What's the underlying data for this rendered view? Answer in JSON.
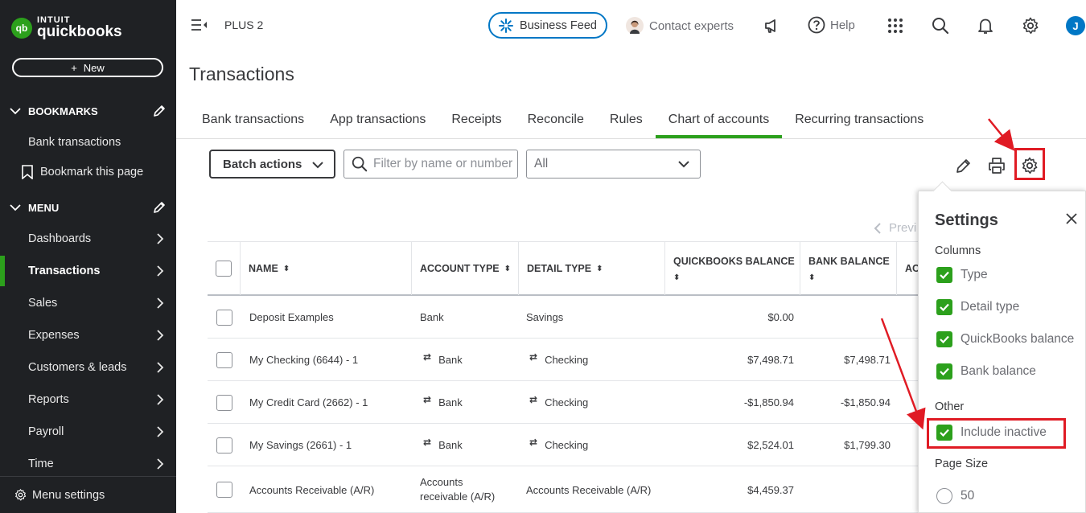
{
  "brand": {
    "mark": "qb",
    "line1": "INTUIT",
    "line2": "quickbooks"
  },
  "sidebar": {
    "new_label": "New",
    "bookmarks_heading": "BOOKMARKS",
    "bookmarks": [
      "Bank transactions",
      "Bookmark this page"
    ],
    "menu_heading": "MENU",
    "menu_items": [
      "Dashboards",
      "Transactions",
      "Sales",
      "Expenses",
      "Customers & leads",
      "Reports",
      "Payroll",
      "Time"
    ],
    "active_item": "Transactions",
    "menu_settings": "Menu settings",
    "accent": "#2ca01c"
  },
  "topbar": {
    "plan": "PLUS 2",
    "business_feed": "Business Feed",
    "contact_experts": "Contact experts",
    "help": "Help",
    "avatar_initial": "J",
    "accent": "#0077c5"
  },
  "page": {
    "title": "Transactions",
    "tabs": [
      "Bank transactions",
      "App transactions",
      "Receipts",
      "Reconcile",
      "Rules",
      "Chart of accounts",
      "Recurring transactions"
    ],
    "active_tab": "Chart of accounts"
  },
  "toolbar": {
    "batch_actions": "Batch actions",
    "filter_placeholder": "Filter by name or number",
    "filter_select": "All",
    "prev": "Previ"
  },
  "table": {
    "headers": [
      "NAME",
      "ACCOUNT TYPE",
      "DETAIL TYPE",
      "QUICKBOOKS BALANCE",
      "BANK BALANCE",
      "ACTI"
    ],
    "rows": [
      {
        "name": "Deposit Examples",
        "account_type": "Bank",
        "detail_type": "Savings",
        "qb_balance": "$0.00",
        "bank_balance": "",
        "linked": false
      },
      {
        "name": "My Checking (6644) - 1",
        "account_type": "Bank",
        "detail_type": "Checking",
        "qb_balance": "$7,498.71",
        "bank_balance": "$7,498.71",
        "linked": true
      },
      {
        "name": "My Credit Card (2662) - 1",
        "account_type": "Bank",
        "detail_type": "Checking",
        "qb_balance": "-$1,850.94",
        "bank_balance": "-$1,850.94",
        "linked": true
      },
      {
        "name": "My Savings (2661) - 1",
        "account_type": "Bank",
        "detail_type": "Checking",
        "qb_balance": "$2,524.01",
        "bank_balance": "$1,799.30",
        "linked": true
      },
      {
        "name": "Accounts Receivable (A/R)",
        "account_type": "Accounts receivable (A/R)",
        "detail_type": "Accounts Receivable (A/R)",
        "qb_balance": "$4,459.37",
        "bank_balance": "",
        "linked": false
      }
    ]
  },
  "settings_panel": {
    "title": "Settings",
    "columns_heading": "Columns",
    "columns": [
      {
        "label": "Type",
        "checked": true
      },
      {
        "label": "Detail type",
        "checked": true
      },
      {
        "label": "QuickBooks balance",
        "checked": true
      },
      {
        "label": "Bank balance",
        "checked": true
      }
    ],
    "other_heading": "Other",
    "other": [
      {
        "label": "Include inactive",
        "checked": true
      }
    ],
    "page_size_heading": "Page Size",
    "page_size_option": "50",
    "highlight_color": "#e01b24"
  }
}
